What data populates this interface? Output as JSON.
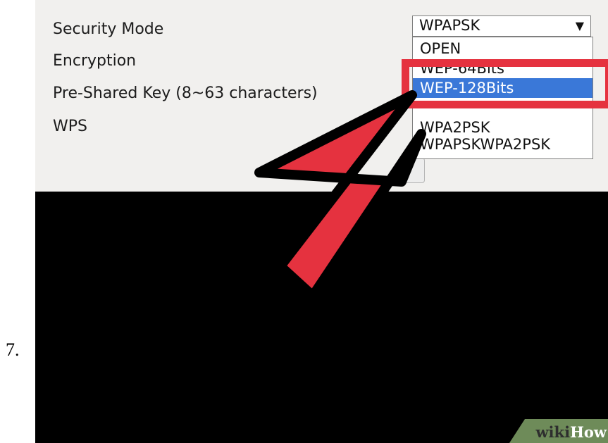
{
  "step": {
    "number": "7."
  },
  "settings": {
    "security_mode_label": "Security Mode",
    "encryption_label": "Encryption",
    "psk_label": "Pre-Shared Key (8~63 characters)",
    "wps_label": "WPS"
  },
  "security_mode_select": {
    "value": "WPAPSK",
    "caret": "▼",
    "options": [
      {
        "label": "OPEN",
        "selected": false
      },
      {
        "label": "WEP-64Bits",
        "selected": false
      },
      {
        "label": "WEP-128Bits",
        "selected": true
      },
      {
        "label": "",
        "selected": false
      },
      {
        "label": "WPA2PSK",
        "selected": false
      },
      {
        "label": "WPAPSKWPA2PSK",
        "selected": false
      }
    ]
  },
  "annotation": {
    "highlight_color": "#e5323f",
    "arrow_color": "#e5323f",
    "arrow_icon": "pointer-arrow-icon"
  },
  "watermark": {
    "wiki": "wiki",
    "how": "How",
    "badge_color": "#6e8b59"
  }
}
